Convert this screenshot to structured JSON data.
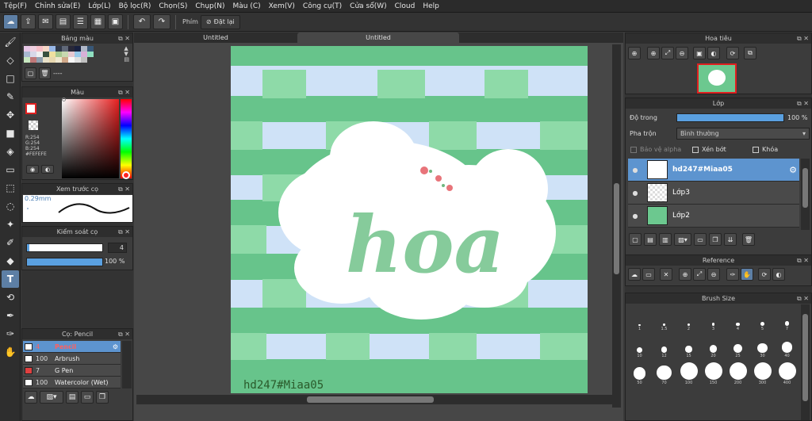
{
  "menu": [
    "Tệp(F)",
    "Chỉnh sửa(E)",
    "Lớp(L)",
    "Bộ lọc(R)",
    "Chọn(S)",
    "Chụp(N)",
    "Màu (C)",
    "Xem(V)",
    "Công cụ(T)",
    "Cửa sổ(W)",
    "Cloud",
    "Help"
  ],
  "toolbar": {
    "phim_label": "Phím",
    "reset_label": "Đặt lại"
  },
  "palette": {
    "title": "Bảng màu",
    "footer_text": "----",
    "swatches": [
      "#e8c8e8",
      "#f0d0e0",
      "#f8c0c8",
      "#f8d8c8",
      "#98b8e8",
      "#303848",
      "#606878",
      "#282838",
      "#182040",
      "#b0b8c8",
      "#385878",
      "#a8b8d0",
      "#d8d8e8",
      "#f0f0f0",
      "#385040",
      "#f0e0a0",
      "#a8c890",
      "#c8d8b0",
      "#e8c8d0",
      "#98c8e8",
      "#d8b0d8",
      "#90e0c0",
      "#c8e8c0",
      "#c07878",
      "#90a0b0",
      "#e8e0c8",
      "#e8d8b0",
      "#f0e8d0",
      "#d0a888",
      "#f8f8f8",
      "#e0e0e0",
      "#c0c0c0"
    ]
  },
  "color_panel": {
    "title": "Màu",
    "rgb_r": "R:254",
    "rgb_g": "G:254",
    "rgb_b": "B:254",
    "hex": "#FEFEFE"
  },
  "brush_preview": {
    "title": "Xem trước cọ",
    "size_label": "0.29mm"
  },
  "brush_control": {
    "title": "Kiểm soát cọ",
    "size_value": "4",
    "opacity_value": "100 %",
    "size_level": 0.03,
    "opacity_level": 1.0
  },
  "brush_list": {
    "title": "Cọ: Pencil",
    "items": [
      {
        "size": "4",
        "name": "Pencil",
        "selected": true,
        "swatch": "#ffffff"
      },
      {
        "size": "100",
        "name": "Arbrush",
        "selected": false,
        "swatch": "#ffffff"
      },
      {
        "size": "7",
        "name": "G Pen",
        "selected": false,
        "swatch": "#e04040"
      },
      {
        "size": "100",
        "name": "Watercolor (Wet)",
        "selected": false,
        "swatch": "#ffffff"
      }
    ]
  },
  "canvas": {
    "tab1": "Untitled",
    "tab2": "Untitled",
    "title_text": "hoa",
    "watermark": "hd247#Miaa05"
  },
  "navigator": {
    "title": "Hoa tiêu"
  },
  "layers": {
    "title": "Lớp",
    "opacity_label": "Độ trong",
    "opacity_value": "100 %",
    "opacity_level": 1.0,
    "blend_label": "Pha trộn",
    "blend_value": "Bình thường",
    "protect_alpha": "Bảo vệ alpha",
    "clipping": "Xén bớt",
    "lock": "Khóa",
    "items": [
      {
        "name": "hd247#Miaa05",
        "selected": true
      },
      {
        "name": "Lớp3",
        "selected": false
      },
      {
        "name": "Lớp2",
        "selected": false
      }
    ]
  },
  "reference": {
    "title": "Reference"
  },
  "brush_size": {
    "title": "Brush Size",
    "sizes": [
      "1",
      "1.5",
      "2",
      "3",
      "4",
      "5",
      "7",
      "10",
      "12",
      "15",
      "20",
      "25",
      "30",
      "40",
      "50",
      "70",
      "100",
      "150",
      "200",
      "300",
      "400"
    ]
  }
}
